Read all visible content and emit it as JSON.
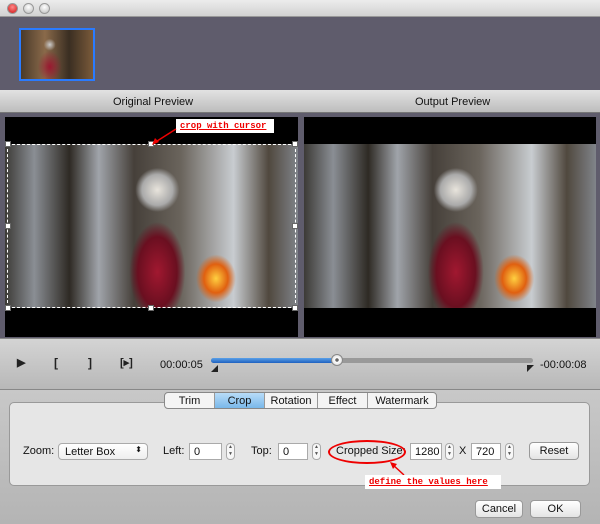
{
  "window": {
    "buttons": [
      "close",
      "minimize",
      "zoom"
    ]
  },
  "preview": {
    "original_label": "Original Preview",
    "output_label": "Output Preview",
    "crop_annotation": "crop with cursor"
  },
  "playback": {
    "current_time": "00:00:05",
    "remaining_time": "-00:00:08",
    "progress_percent": 39,
    "play_icon": "▶",
    "mark_in_icon": "[",
    "mark_out_icon": "]",
    "next_icon": "[▸]"
  },
  "tabs": [
    {
      "label": "Trim"
    },
    {
      "label": "Crop",
      "active": true
    },
    {
      "label": "Rotation"
    },
    {
      "label": "Effect"
    },
    {
      "label": "Watermark"
    }
  ],
  "crop": {
    "zoom_label": "Zoom:",
    "zoom_value": "Letter Box",
    "left_label": "Left:",
    "left_value": "0",
    "top_label": "Top:",
    "top_value": "0",
    "size_label": "Cropped Size:",
    "width_value": "1280",
    "x_label": "X",
    "height_value": "720",
    "reset_label": "Reset",
    "size_annotation": "define the values here"
  },
  "footer": {
    "cancel_label": "Cancel",
    "ok_label": "OK"
  },
  "colors": {
    "accent": "#2a7bff",
    "annotation": "#e00000",
    "active_tab": "#7ab8ea"
  }
}
